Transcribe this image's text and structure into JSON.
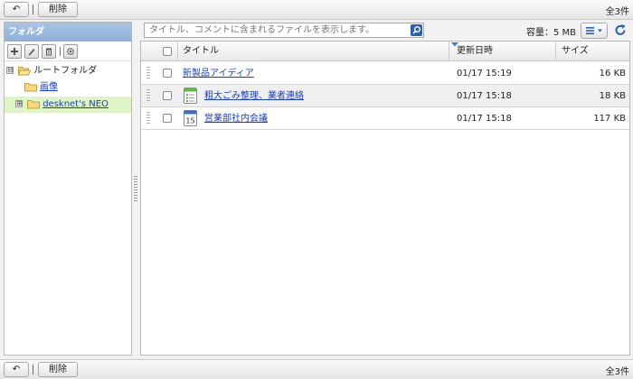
{
  "toolbar": {
    "back_label": "↶",
    "delete_label": "削除",
    "count": "全3件"
  },
  "footer": {
    "back_label": "↶",
    "delete_label": "削除",
    "count": "全3件"
  },
  "folder_panel": {
    "title": "フォルダ",
    "tools": [
      "add-icon",
      "edit-icon",
      "trash-icon",
      "gear-icon"
    ],
    "tree": {
      "root": {
        "label": "ルートフォルダ",
        "expander": "⊟"
      },
      "child1": {
        "label": "画像"
      },
      "child2": {
        "label": "desknet's NEO",
        "expander": "⊞",
        "selected": true
      }
    }
  },
  "search": {
    "placeholder": "タイトル、コメントに含まれるファイルを表示します。"
  },
  "capacity": "容量：5 MB",
  "table": {
    "headers": {
      "title": "タイトル",
      "updated": "更新日時",
      "size": "サイズ"
    },
    "rows": [
      {
        "title": "新製品アイディア",
        "updated": "01/17 15:19",
        "size": "16 KB",
        "icon": "none"
      },
      {
        "title": "粗大ごみ整理、業者連絡",
        "updated": "01/17 15:18",
        "size": "18 KB",
        "icon": "todo-list-icon"
      },
      {
        "title": "営業部社内会議",
        "updated": "01/17 15:18",
        "size": "117 KB",
        "icon": "calendar-icon",
        "calendar_day": "15"
      }
    ]
  },
  "colors": {
    "accent": "#2d5fb1",
    "selected_bg": "#dff5c5",
    "panel_header": "#9ab8de"
  }
}
